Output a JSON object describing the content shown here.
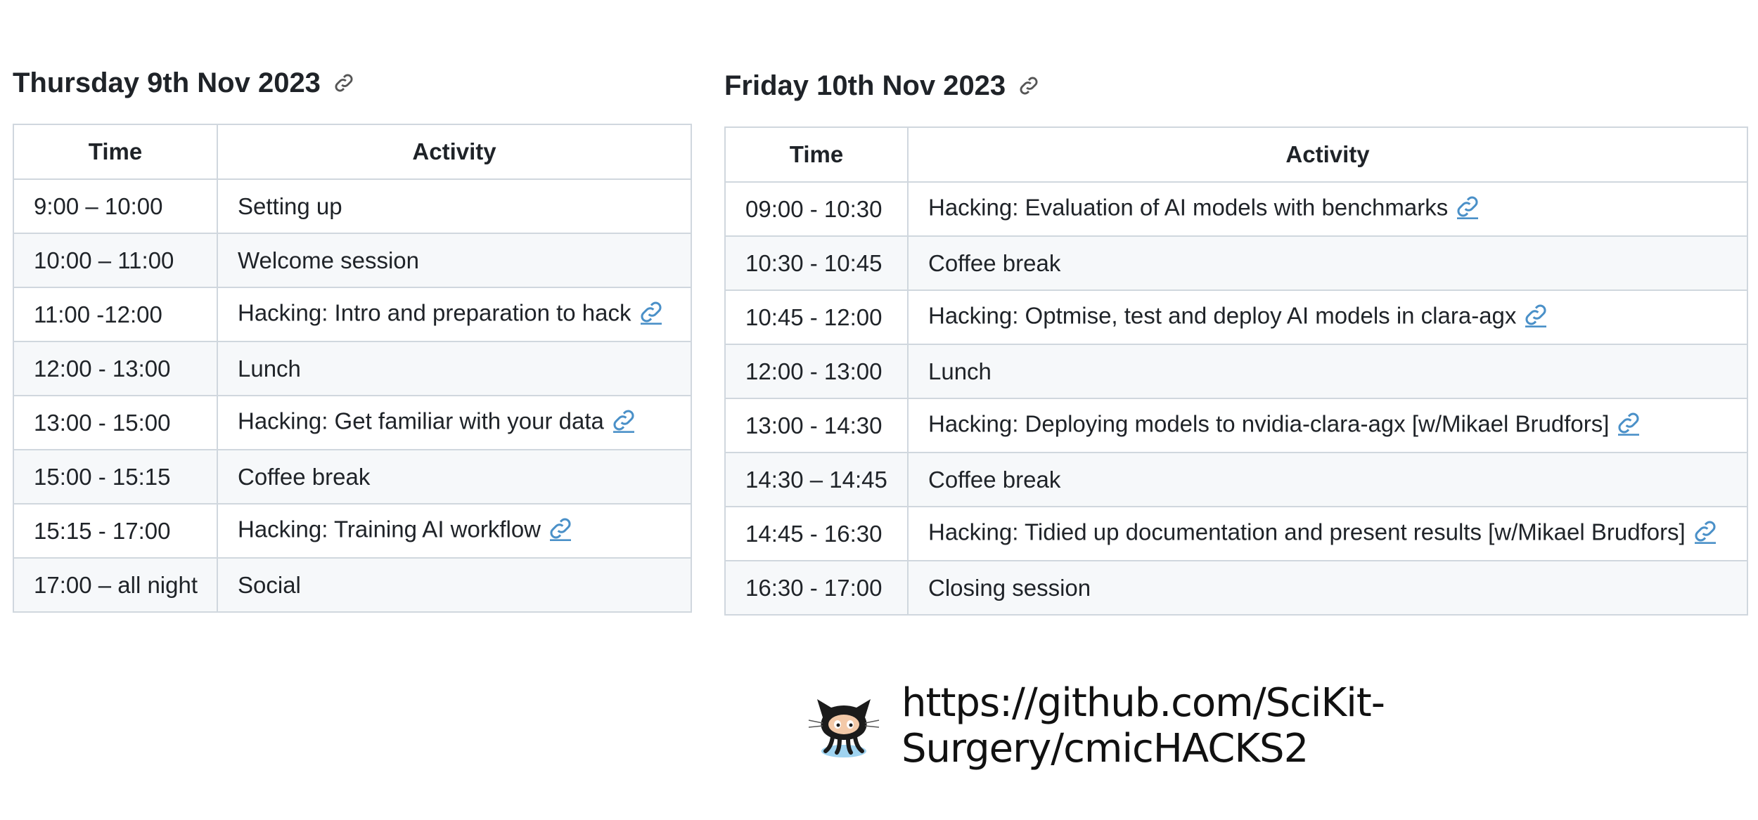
{
  "thursday": {
    "heading": "Thursday 9th Nov 2023",
    "columns": [
      "Time",
      "Activity"
    ],
    "rows": [
      {
        "time": "9:00 – 10:00",
        "activity": "Setting up",
        "link": false
      },
      {
        "time": "10:00 – 11:00",
        "activity": "Welcome session",
        "link": false
      },
      {
        "time": "11:00 -12:00",
        "activity": "Hacking: Intro and preparation to hack",
        "link": true
      },
      {
        "time": "12:00 - 13:00",
        "activity": "Lunch",
        "link": false
      },
      {
        "time": "13:00 - 15:00",
        "activity": "Hacking: Get familiar with your data",
        "link": true
      },
      {
        "time": "15:00 - 15:15",
        "activity": "Coffee break",
        "link": false
      },
      {
        "time": "15:15 - 17:00",
        "activity": "Hacking: Training AI workflow",
        "link": true
      },
      {
        "time": "17:00 – all night",
        "activity": "Social",
        "link": false
      }
    ]
  },
  "friday": {
    "heading": "Friday 10th Nov 2023",
    "columns": [
      "Time",
      "Activity"
    ],
    "rows": [
      {
        "time": "09:00 - 10:30",
        "activity": "Hacking: Evaluation of AI models with benchmarks",
        "link": true
      },
      {
        "time": "10:30 - 10:45",
        "activity": "Coffee break",
        "link": false
      },
      {
        "time": "10:45 - 12:00",
        "activity": "Hacking: Optmise, test and deploy AI models in clara-agx",
        "link": true
      },
      {
        "time": "12:00 - 13:00",
        "activity": "Lunch",
        "link": false
      },
      {
        "time": "13:00 - 14:30",
        "activity": "Hacking: Deploying models to nvidia-clara-agx [w/Mikael Brudfors]",
        "link": true
      },
      {
        "time": "14:30 – 14:45",
        "activity": "Coffee break",
        "link": false
      },
      {
        "time": "14:45 - 16:30",
        "activity": "Hacking: Tidied up documentation and present results [w/Mikael Brudfors]",
        "link": true
      },
      {
        "time": "16:30 - 17:00",
        "activity": "Closing session",
        "link": false
      }
    ]
  },
  "footer": {
    "repo_url": "https://github.com/SciKit-Surgery/cmicHACKS2",
    "logo_icon": "github-octocat-icon"
  },
  "colors": {
    "link": "#4a90c8",
    "border": "#d0d7de",
    "row_alt": "#f6f8fa",
    "text": "#1f2328"
  }
}
